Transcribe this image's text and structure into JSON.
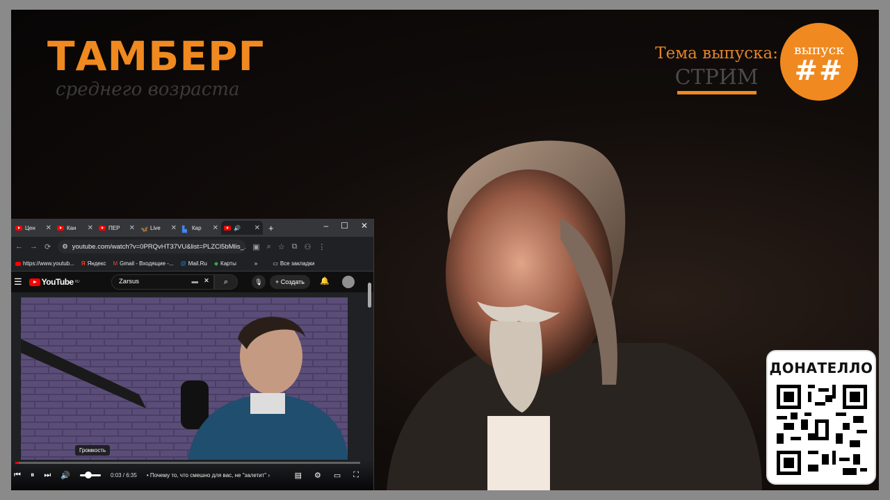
{
  "brand": {
    "title": "ТАМБЕРГ",
    "subtitle": "среднего возраста"
  },
  "episode": {
    "theme_label": "Тема выпуска:",
    "theme_value": "СТРИМ",
    "badge_top": "выпуск",
    "badge_number": "##"
  },
  "donate": {
    "title": "ДОНАТЕЛЛО"
  },
  "browser": {
    "tabs": [
      {
        "label": "Цен",
        "icon": "youtube-icon"
      },
      {
        "label": "Кан",
        "icon": "youtube-icon"
      },
      {
        "label": "ПЕР",
        "icon": "youtube-icon"
      },
      {
        "label": "Live",
        "icon": "bluesky-icon"
      },
      {
        "label": "Кар",
        "icon": "maps-icon"
      },
      {
        "label": "",
        "icon": "youtube-icon",
        "active": true
      }
    ],
    "url": "youtube.com/watch?v=0PRQvHT37VU&list=PLZCl5bMlis_...",
    "bookmarks": [
      {
        "label": "https://www.youtub...",
        "icon": "youtube-icon"
      },
      {
        "label": "Яндекс",
        "icon": "yandex-icon"
      },
      {
        "label": "Gmail - Входящие -...",
        "icon": "gmail-icon"
      },
      {
        "label": "Mail.Ru",
        "icon": "mailru-icon"
      },
      {
        "label": "Карты",
        "icon": "maps-icon"
      }
    ],
    "all_bookmarks": "Все закладки"
  },
  "youtube": {
    "logo": "YouTube",
    "logo_region": "RU",
    "search_value": "Zarsus",
    "create_label": "Создать",
    "tooltip": "Громкость",
    "time": "0:03 / 6:35",
    "chapter": "Почему то, что смешно для вас, не \"залетит\"",
    "progress": 0.008,
    "volume": 0.4
  }
}
